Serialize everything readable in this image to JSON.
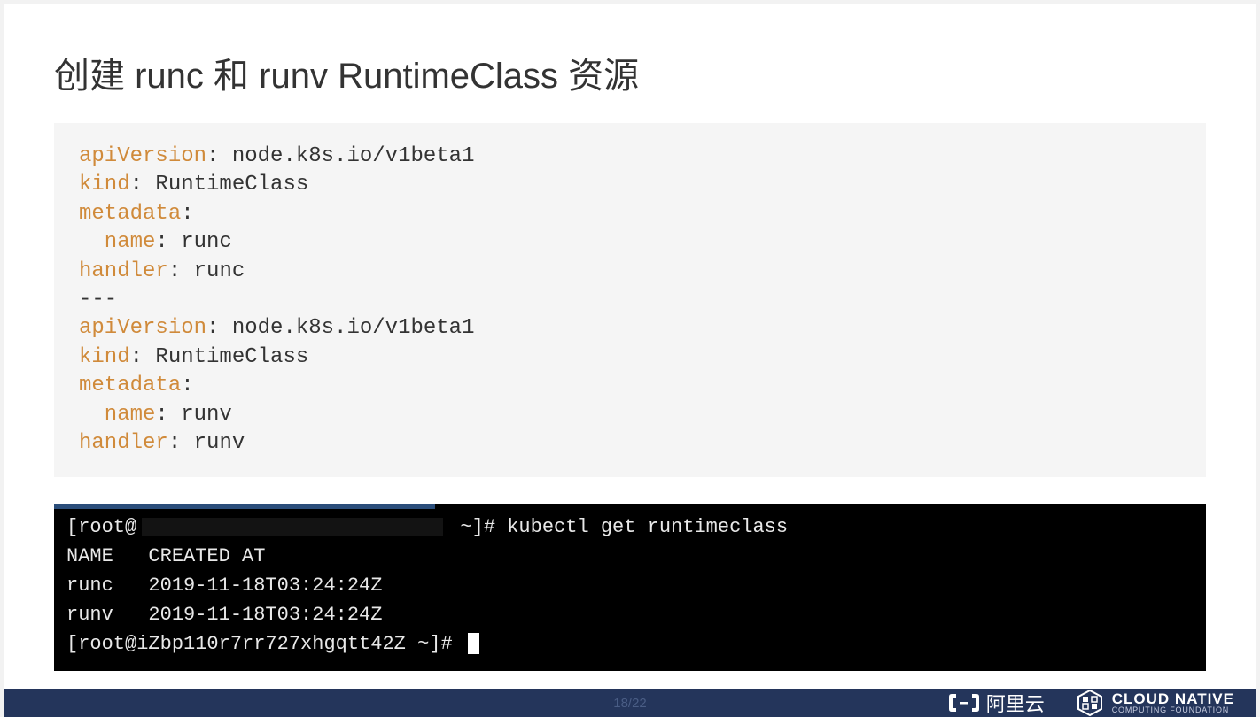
{
  "slide": {
    "title": "创建 runc 和 runv RuntimeClass 资源",
    "yaml": {
      "doc1": {
        "apiVersion_key": "apiVersion",
        "apiVersion_val": ": node.k8s.io/v1beta1",
        "kind_key": "kind",
        "kind_val": ": RuntimeClass",
        "metadata_key": "metadata",
        "metadata_val": ":",
        "name_key": "  name",
        "name_val": ": runc",
        "handler_key": "handler",
        "handler_val": ": runc"
      },
      "sep": "---",
      "doc2": {
        "apiVersion_key": "apiVersion",
        "apiVersion_val": ": node.k8s.io/v1beta1",
        "kind_key": "kind",
        "kind_val": ": RuntimeClass",
        "metadata_key": "metadata",
        "metadata_val": ":",
        "name_key": "  name",
        "name_val": ": runv",
        "handler_key": "handler",
        "handler_val": ": runv"
      }
    },
    "terminal": {
      "prompt1_pre": "[root@",
      "prompt1_post": " ~]# kubectl get runtimeclass",
      "header": "NAME   CREATED AT",
      "row1": "runc   2019-11-18T03:24:24Z",
      "row2": "runv   2019-11-18T03:24:24Z",
      "prompt2": "[root@iZbp110r7rr727xhgqtt42Z ~]# "
    }
  },
  "footer": {
    "pager": "18/22",
    "alicloud_label": "阿里云",
    "cncf_main": "CLOUD NATIVE",
    "cncf_sub": "COMPUTING FOUNDATION"
  }
}
